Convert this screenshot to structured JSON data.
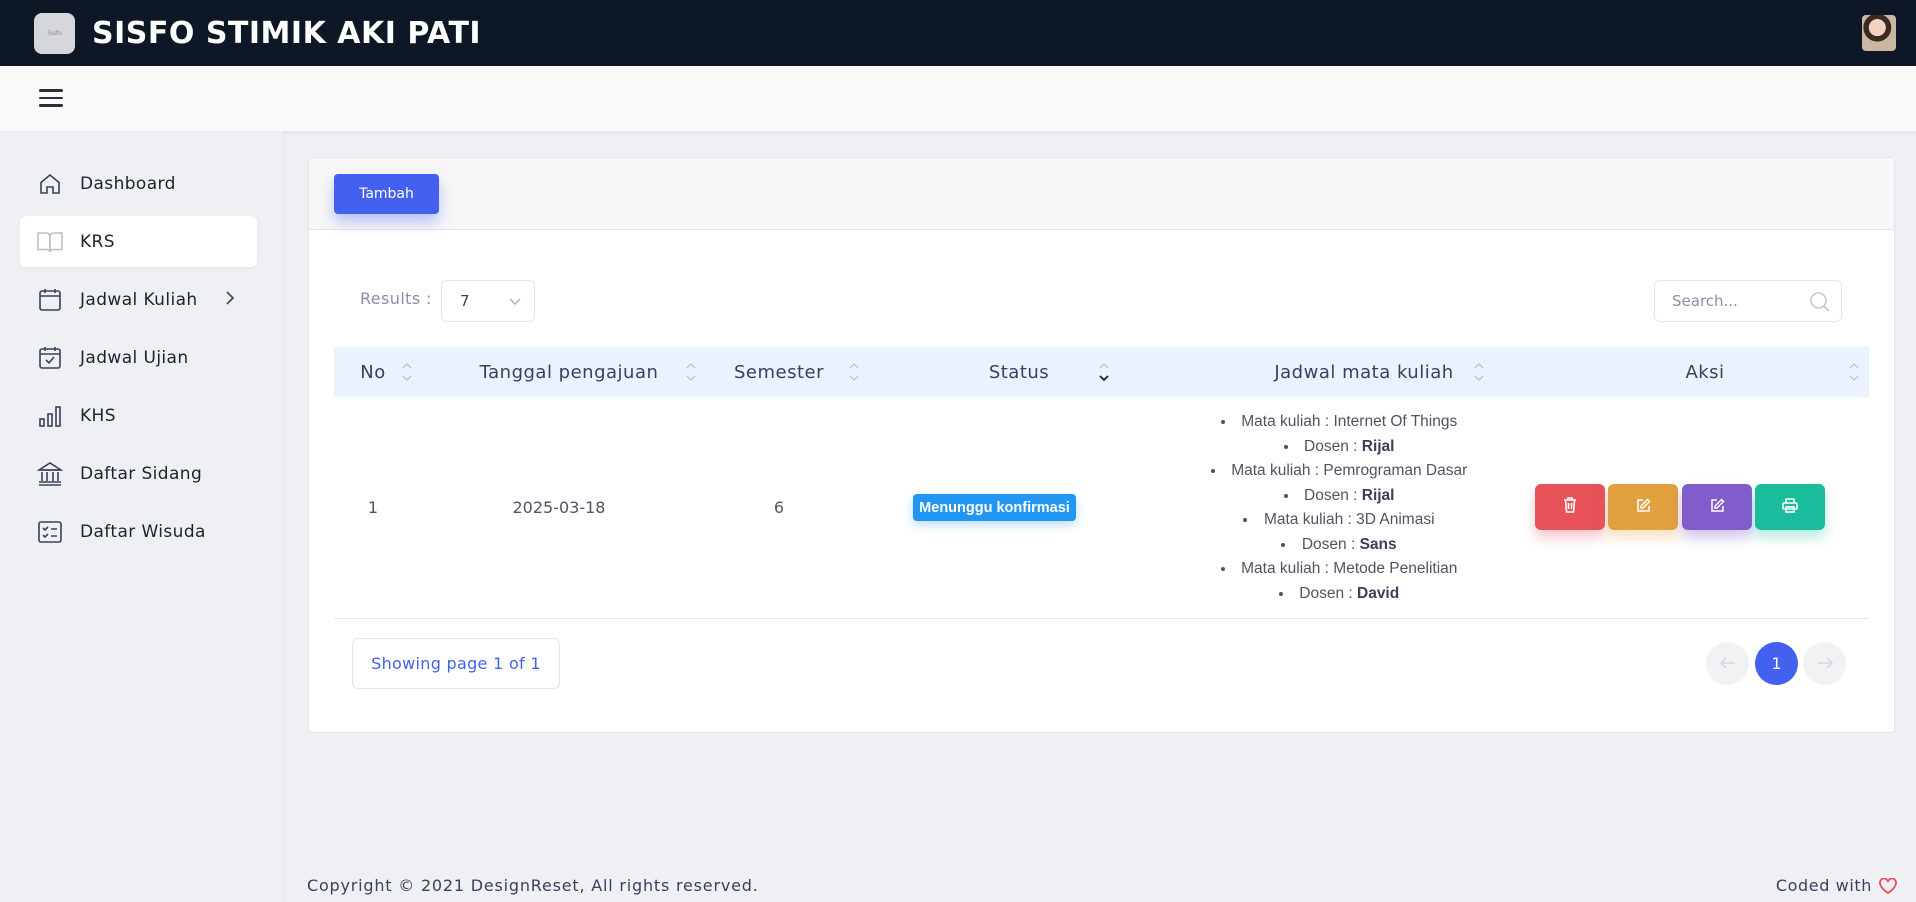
{
  "app": {
    "title": "SISFO STIMIK AKI PATI",
    "logo_text": "Sisfo"
  },
  "colors": {
    "topbar": "#0e1726",
    "primary": "#4361ee",
    "danger": "#e7515a",
    "warning": "#e2a03f",
    "secondary": "#805dca",
    "success": "#1abc9c",
    "info": "#2196f3"
  },
  "sidebar": {
    "items": [
      {
        "label": "Dashboard",
        "icon": "home-icon"
      },
      {
        "label": "KRS",
        "icon": "book-icon",
        "active": true
      },
      {
        "label": "Jadwal Kuliah",
        "icon": "calendar-icon",
        "has_submenu": true
      },
      {
        "label": "Jadwal Ujian",
        "icon": "calendar-check-icon"
      },
      {
        "label": "KHS",
        "icon": "bar-chart-icon"
      },
      {
        "label": "Daftar Sidang",
        "icon": "bank-icon"
      },
      {
        "label": "Daftar Wisuda",
        "icon": "checklist-icon"
      }
    ]
  },
  "toolbar": {
    "add_label": "Tambah"
  },
  "table_controls": {
    "results_label": "Results :",
    "results_value": "7",
    "search_placeholder": "Search..."
  },
  "table": {
    "columns": [
      "No",
      "Tanggal pengajuan",
      "Semester",
      "Status",
      "Jadwal mata kuliah",
      "Aksi"
    ],
    "rows": [
      {
        "no": "1",
        "tanggal": "2025-03-18",
        "semester": "6",
        "status": "Menunggu konfirmasi",
        "jadwal": [
          {
            "mk_prefix": "Mata kuliah : ",
            "mk": "Internet Of Things",
            "dosen_prefix": "Dosen : ",
            "dosen": "Rijal"
          },
          {
            "mk_prefix": "Mata kuliah : ",
            "mk": "Pemrograman Dasar",
            "dosen_prefix": "Dosen : ",
            "dosen": "Rijal"
          },
          {
            "mk_prefix": "Mata kuliah : ",
            "mk": "3D Animasi",
            "dosen_prefix": "Dosen : ",
            "dosen": "Sans"
          },
          {
            "mk_prefix": "Mata kuliah : ",
            "mk": "Metode Penelitian",
            "dosen_prefix": "Dosen : ",
            "dosen": "David"
          }
        ],
        "actions": [
          "trash-icon",
          "edit-icon",
          "edit-icon",
          "print-icon"
        ]
      }
    ]
  },
  "pagination": {
    "showing": "Showing page 1 of 1",
    "current": "1"
  },
  "footer": {
    "copyright": "Copyright © 2021 DesignReset, All rights reserved.",
    "coded": "Coded with"
  }
}
